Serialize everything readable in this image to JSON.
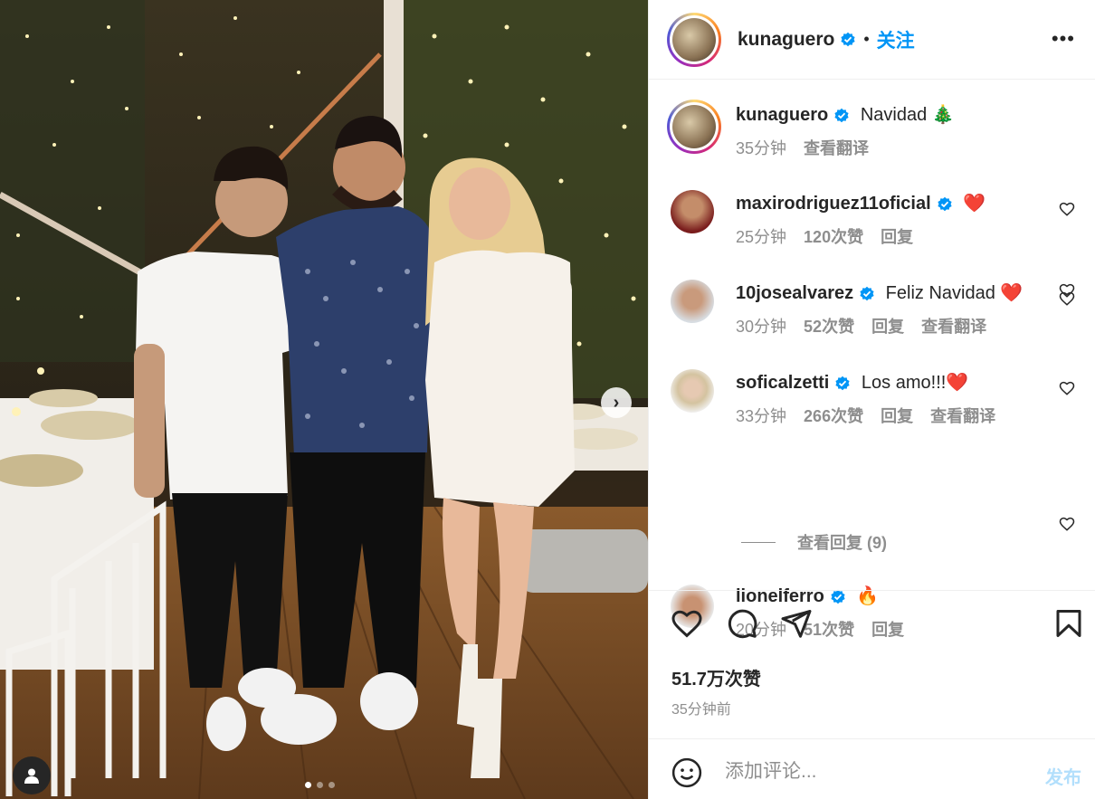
{
  "post": {
    "author": "kunaguero",
    "follow_label": "关注",
    "bullet": "•",
    "more_label": "•••"
  },
  "caption": {
    "user": "kunaguero",
    "text": "Navidad 🎄",
    "time": "35分钟",
    "translate": "查看翻译"
  },
  "comments": [
    {
      "user": "maxirodriguez11oficial",
      "text": "❤️",
      "time": "25分钟",
      "likes": "120次赞",
      "reply": "回复",
      "translate": ""
    },
    {
      "user": "10josealvarez",
      "text": "Feliz Navidad ❤️",
      "time": "30分钟",
      "likes": "52次赞",
      "reply": "回复",
      "translate": "查看翻译"
    },
    {
      "user": "soficalzetti",
      "text": "Los amo!!!❤️",
      "time": "33分钟",
      "likes": "266次赞",
      "reply": "回复",
      "translate": "查看翻译"
    },
    {
      "user": "lionelferro",
      "text": "🔥",
      "time": "20分钟",
      "likes": "51次赞",
      "reply": "回复",
      "translate": ""
    }
  ],
  "view_replies": "查看回复 (9)",
  "likes_count": "51.7万次赞",
  "posted_ago": "35分钟前",
  "comment_box": {
    "placeholder": "添加评论...",
    "post_label": "发布"
  },
  "carousel": {
    "count": 3,
    "active": 1
  },
  "icons": [
    "like-icon",
    "comment-icon",
    "share-icon",
    "save-icon",
    "emoji-icon",
    "verified-icon",
    "more-icon",
    "chevron-right-icon",
    "user-tag-icon"
  ],
  "colors": {
    "accent": "#0095f6",
    "verified": "#0095f6",
    "muted": "#8e8e8e",
    "post_disabled": "#b2dffc"
  }
}
